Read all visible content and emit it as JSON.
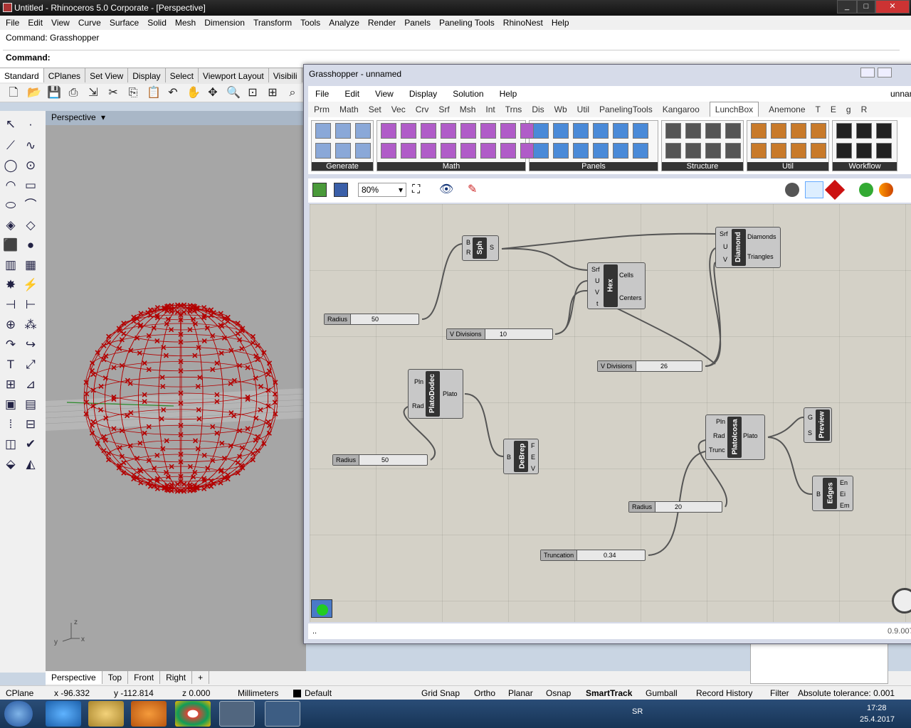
{
  "window": {
    "title": "Untitled - Rhinoceros  5.0 Corporate - [Perspective]"
  },
  "menu": [
    "File",
    "Edit",
    "View",
    "Curve",
    "Surface",
    "Solid",
    "Mesh",
    "Dimension",
    "Transform",
    "Tools",
    "Analyze",
    "Render",
    "Panels",
    "Paneling Tools",
    "RhinoNest",
    "Help"
  ],
  "command": {
    "history": "Command: Grasshopper",
    "prompt": "Command:"
  },
  "rhino_tabs": [
    "Standard",
    "CPlanes",
    "Set View",
    "Display",
    "Select",
    "Viewport Layout",
    "Visibili"
  ],
  "viewport": {
    "name": "Perspective",
    "axis": {
      "z": "z",
      "y": "y",
      "x": "x"
    }
  },
  "viewport_tabs": [
    "Perspective",
    "Top",
    "Front",
    "Right",
    "+"
  ],
  "status": {
    "cplane": "CPlane",
    "x": "x -96.332",
    "y": "y -112.814",
    "z": "z 0.000",
    "units": "Millimeters",
    "layer": "Default",
    "grid": "Grid Snap",
    "ortho": "Ortho",
    "planar": "Planar",
    "osnap": "Osnap",
    "smarttrack": "SmartTrack",
    "gumball": "Gumball",
    "history": "Record History",
    "filter": "Filter",
    "tolerance": "Absolute tolerance: 0.001"
  },
  "taskbar": {
    "lang": "SR",
    "time": "17:28",
    "date": "25.4.2017"
  },
  "grasshopper": {
    "title": "Grasshopper - unnamed",
    "menu": [
      "File",
      "Edit",
      "View",
      "Display",
      "Solution",
      "Help"
    ],
    "menu_right": "unnan",
    "tabs": [
      "Prm",
      "Math",
      "Set",
      "Vec",
      "Crv",
      "Srf",
      "Msh",
      "Int",
      "Trns",
      "Dis",
      "Wb",
      "Util",
      "PanelingTools",
      "Kangaroo",
      "LunchBox",
      "Anemone",
      "T",
      "E",
      "g",
      "R"
    ],
    "active_tab": "LunchBox",
    "panels": [
      "Generate",
      "Math",
      "Panels",
      "Structure",
      "Util",
      "Workflow"
    ],
    "zoom": "80%",
    "version": "0.9.007",
    "status_left": "..",
    "components": {
      "sph": {
        "name": "Sph",
        "in": [
          "B",
          "R"
        ],
        "out": [
          "S"
        ]
      },
      "hex": {
        "name": "Hex",
        "in": [
          "Srf",
          "U",
          "V",
          "t"
        ],
        "out": [
          "Cells",
          "Centers"
        ]
      },
      "diamond": {
        "name": "Diamond",
        "in": [
          "Srf",
          "U",
          "V"
        ],
        "out": [
          "Diamonds",
          "Triangles"
        ]
      },
      "platododec": {
        "name": "PlatoDodec",
        "in": [
          "Pln",
          "Rad"
        ],
        "out": [
          "Plato"
        ]
      },
      "debrep": {
        "name": "DeBrep",
        "in": [
          "B"
        ],
        "out": [
          "F",
          "E",
          "V"
        ]
      },
      "platoicosa": {
        "name": "PlatoIcosa",
        "in": [
          "Pln",
          "Rad",
          "Trunc"
        ],
        "out": [
          "Plato"
        ]
      },
      "preview": {
        "name": "Preview",
        "in": [
          "G",
          "S"
        ],
        "out": []
      },
      "edges": {
        "name": "Edges",
        "in": [
          "B"
        ],
        "out": [
          "En",
          "Ei",
          "Em"
        ]
      }
    },
    "sliders": {
      "radius1": {
        "label": "Radius",
        "value": "50"
      },
      "vdiv1": {
        "label": "V Divisions",
        "value": "10"
      },
      "vdiv2": {
        "label": "V Divisions",
        "value": "26"
      },
      "radius2": {
        "label": "Radius",
        "value": "50"
      },
      "radius3": {
        "label": "Radius",
        "value": "20"
      },
      "trunc": {
        "label": "Truncation",
        "value": "0.34"
      }
    }
  },
  "colors": {
    "sphere": "#b30000",
    "canvas": "#d4d1c7",
    "viewport": "#a6a6a6"
  }
}
